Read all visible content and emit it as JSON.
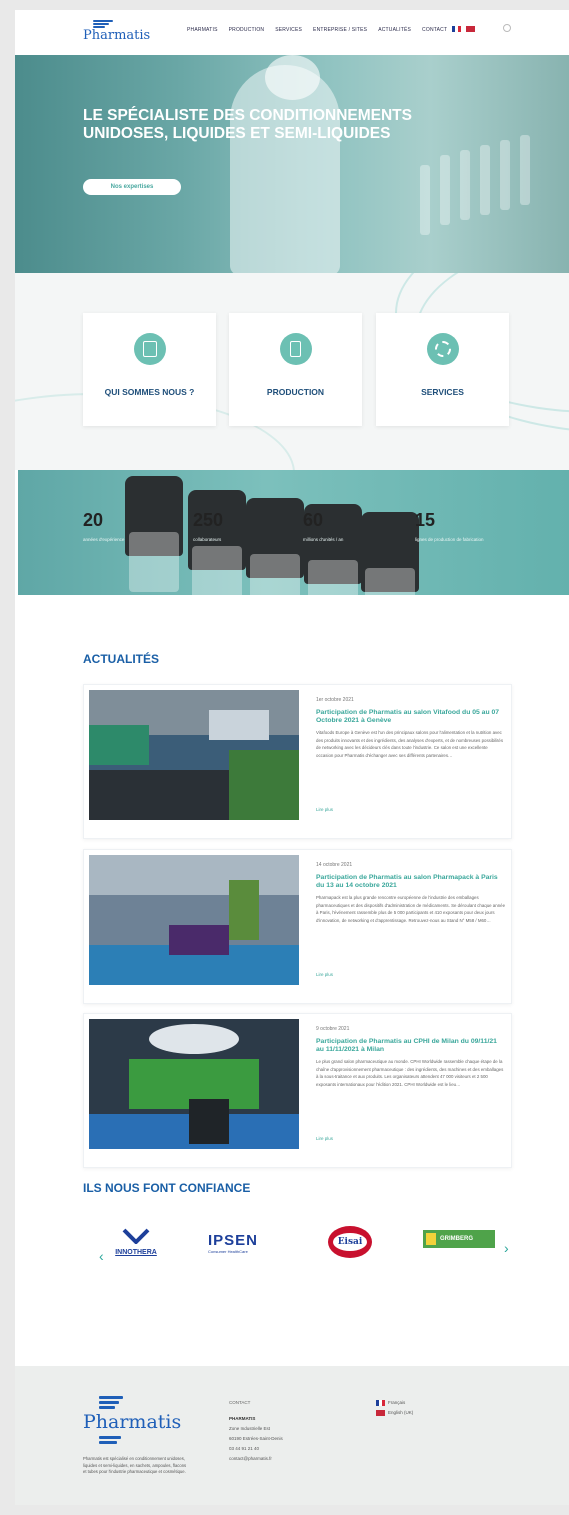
{
  "brand": {
    "name": "Pharmatis"
  },
  "nav": {
    "items": [
      "Pharmatis",
      "Production",
      "Services",
      "Entreprise / Sites",
      "Actualités",
      "Contact"
    ]
  },
  "hero": {
    "title": "Le spécialiste des conditionnements unidoses, liquides et semi-liquides",
    "cta": "Nos expertises"
  },
  "cards": [
    {
      "label": "Qui sommes nous ?",
      "icon": "building-icon"
    },
    {
      "label": "Production",
      "icon": "phone-dashboard-icon"
    },
    {
      "label": "Services",
      "icon": "gear-icon"
    }
  ],
  "stats": [
    {
      "value": "20",
      "label": "années d'expérience"
    },
    {
      "value": "250",
      "label": "collaborateurs"
    },
    {
      "value": "60",
      "label": "millions d'unités / an"
    },
    {
      "value": "15",
      "label": "lignes de production de fabrication"
    }
  ],
  "news": {
    "title": "Actualités",
    "items": [
      {
        "date": "1er octobre 2021",
        "title": "Participation de Pharmatis au salon Vitafood du 05 au 07 Octobre 2021 à Genève",
        "excerpt": "Vitafoods Europe à Genève est l'un des principaux salons pour l'alimentation et la nutrition avec des produits innovants et des ingrédients, des analyses d'experts, et de nombreuses possibilités de networking avec les décideurs clés dans toute l'industrie. Ce salon est une excellente occasion pour Pharmatis d'échanger avec ses différents partenaires…",
        "more": "Lire plus"
      },
      {
        "date": "14 octobre 2021",
        "title": "Participation de Pharmatis au salon Pharmapack à Paris du 13 au 14 octobre 2021",
        "excerpt": "Pharmapack est la plus grande rencontre européenne de l'industrie des emballages pharmaceutiques et des dispositifs d'administration de médicaments. Se déroulant chaque année à Paris, l'événement rassemble plus de 5 000 participants et 410 exposants pour deux jours d'innovation, de networking et d'apprentissage. Retrouvez-nous au Stand N° M58 / M60…",
        "more": "Lire plus"
      },
      {
        "date": "9 octobre 2021",
        "title": "Participation de Pharmatis au CPHI de Milan du 09/11/21 au 11/11/2021 à Milan",
        "excerpt": "Le plus grand salon pharmaceutique au monde. CPHI Worldwide rassemble chaque étape de la chaîne d'approvisionnement pharmaceutique : des ingrédients, des machines et des emballages à la sous-traitance et aux produits. Les organisateurs attendent 47 000 visiteurs et 2 500 exposants internationaux pour l'édition 2021. CPHI Worldwide est le lieu…",
        "more": "Lire plus"
      }
    ]
  },
  "partners": {
    "title": "Ils nous font confiance",
    "logos": [
      "INNOTHERA",
      "IPSEN",
      "Eisai",
      "GRIMBERG"
    ],
    "ipsen_sub": "Consumer HealthCare"
  },
  "footer": {
    "about": "Pharmatis est spécialisé en conditionnement unidoses, liquides et semi-liquides, en sachets, ampoules, flacons et tubes pour l'industrie pharmaceutique et cosmétique.",
    "contact_heading": "Contact",
    "contact_name": "PHARMATIS",
    "contact_lines": [
      "Zone Industrielle Est",
      "60190 Estrées-Saint-Denis",
      "03 44 91 21 40",
      "contact@pharmatis.fr"
    ],
    "languages": [
      "Français",
      "English (UK)"
    ]
  },
  "colors": {
    "teal": "#3aa79b",
    "brandBlue": "#1a5fa6",
    "heroTeal": "#6aa7a6"
  }
}
